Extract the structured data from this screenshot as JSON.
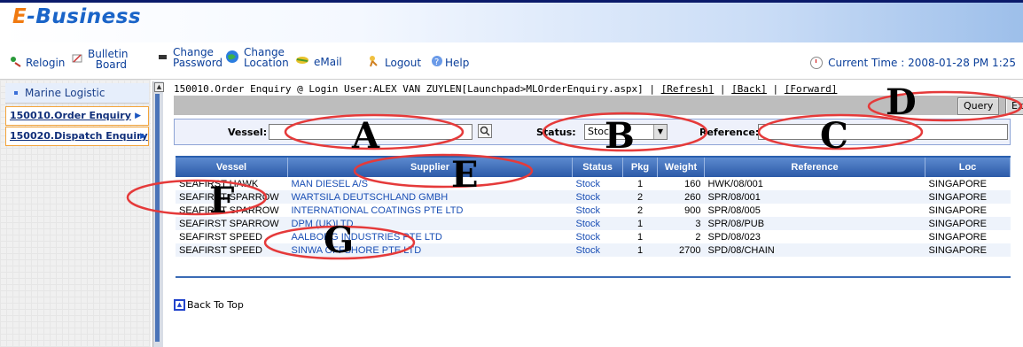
{
  "brand": {
    "prefix": "E",
    "name": "-Business"
  },
  "toolbar": {
    "items": [
      {
        "label": "Relogin"
      },
      {
        "label": "Bulletin Board"
      },
      {
        "label": "Change Password"
      },
      {
        "label": "Change Location"
      },
      {
        "label": "eMail"
      },
      {
        "label": "Logout"
      },
      {
        "label": "Help"
      }
    ],
    "time_label": "Current Time : 2008-01-28 PM 1:25"
  },
  "sidebar": {
    "header": "Marine Logistic",
    "items": [
      {
        "label": "150010.Order Enquiry"
      },
      {
        "label": "150020.Dispatch Enquiry"
      }
    ]
  },
  "breadcrumb": {
    "text": "150010.Order Enquiry @ Login User:ALEX VAN ZUYLEN[Launchpad>MLOrderEnquiry.aspx] | ",
    "refresh": "[Refresh]",
    "back": "[Back]",
    "forward": "[Forward]",
    "sep": " | "
  },
  "actions": {
    "query": "Query",
    "export": "Export"
  },
  "filters": {
    "vessel_label": "Vessel:",
    "vessel_value": "",
    "status_label": "Status:",
    "status_value": "Stock",
    "reference_label": "Reference:",
    "reference_value": ""
  },
  "table": {
    "columns": [
      "Vessel",
      "Supplier",
      "Status",
      "Pkg",
      "Weight",
      "Reference",
      "Loc"
    ],
    "rows": [
      {
        "vessel": "SEAFIRST HAWK",
        "supplier": "MAN DIESEL A/S",
        "status": "Stock",
        "pkg": "1",
        "weight": "160",
        "reference": "HWK/08/001",
        "loc": "SINGAPORE"
      },
      {
        "vessel": "SEAFIRST SPARROW",
        "supplier": "WARTSILA DEUTSCHLAND GMBH",
        "status": "Stock",
        "pkg": "2",
        "weight": "260",
        "reference": "SPR/08/001",
        "loc": "SINGAPORE"
      },
      {
        "vessel": "SEAFIRST SPARROW",
        "supplier": "INTERNATIONAL COATINGS PTE LTD",
        "status": "Stock",
        "pkg": "2",
        "weight": "900",
        "reference": "SPR/08/005",
        "loc": "SINGAPORE"
      },
      {
        "vessel": "SEAFIRST SPARROW",
        "supplier": "DPM (UK)LTD",
        "status": "Stock",
        "pkg": "1",
        "weight": "3",
        "reference": "SPR/08/PUB",
        "loc": "SINGAPORE"
      },
      {
        "vessel": "SEAFIRST SPEED",
        "supplier": "AALBORG INDUSTRIES PTE LTD",
        "status": "Stock",
        "pkg": "1",
        "weight": "2",
        "reference": "SPD/08/023",
        "loc": "SINGAPORE"
      },
      {
        "vessel": "SEAFIRST SPEED",
        "supplier": "SINWA OFFSHORE PTE LTD",
        "status": "Stock",
        "pkg": "1",
        "weight": "2700",
        "reference": "SPD/08/CHAIN",
        "loc": "SINGAPORE"
      }
    ]
  },
  "back_to_top": "Back To Top",
  "annotations": {
    "a": "A",
    "b": "B",
    "c": "C",
    "d": "D",
    "e": "E",
    "f": "F",
    "g": "G",
    "color": "#e53a3a"
  }
}
